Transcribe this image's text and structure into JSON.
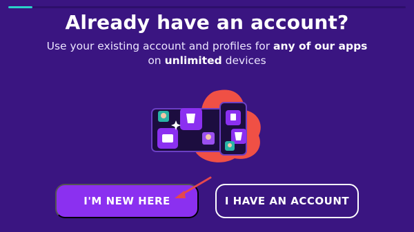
{
  "progress": {
    "value": 0.06,
    "track_color": "#2d0f6b",
    "fill_color": "#2ad1c9"
  },
  "title": "Already have an account?",
  "subtitle": {
    "part1": "Use your existing account and profiles for ",
    "bold1": "any of our apps",
    "part2": " on ",
    "bold2": "unlimited",
    "part3": " devices"
  },
  "illustration": {
    "icon": "devices-illustration"
  },
  "buttons": {
    "new_label": "I'M NEW HERE",
    "have_account_label": "I HAVE AN ACCOUNT"
  },
  "annotation": {
    "icon": "red-arrow-icon",
    "color": "#e5484d"
  },
  "colors": {
    "background": "#3a1581",
    "accent": "#8b30f0",
    "blob": "#f05045"
  }
}
